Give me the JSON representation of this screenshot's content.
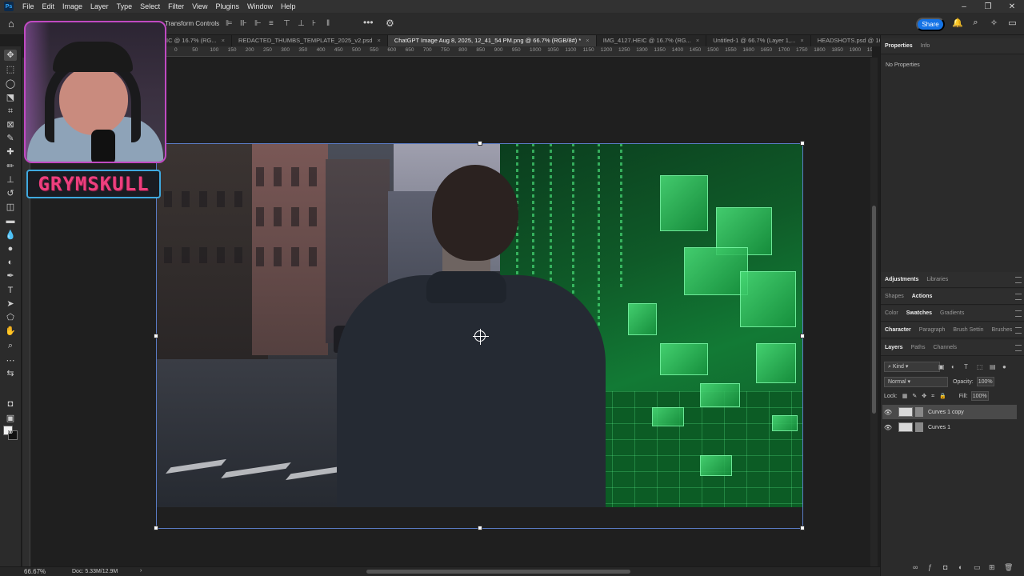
{
  "menu": [
    "File",
    "Edit",
    "Image",
    "Layer",
    "Type",
    "Select",
    "Filter",
    "View",
    "Plugins",
    "Window",
    "Help"
  ],
  "app_logo": "Ps",
  "window_controls": [
    "–",
    "❐",
    "✕"
  ],
  "options": {
    "label": "Transform Controls",
    "share_label": "Share"
  },
  "tabs": [
    {
      "label": "IC @ 16.7% (RG...",
      "active": false
    },
    {
      "label": "REDACTED_THUMBS_TEMPLATE_2025_v2.psd",
      "active": false
    },
    {
      "label": "ChatGPT Image Aug 8, 2025, 12_41_54 PM.png @ 66.7% (RGB/8#) *",
      "active": true
    },
    {
      "label": "IMG_4127.HEIC @ 16.7% (RG...",
      "active": false
    },
    {
      "label": "Untitled-1 @ 66.7% (Layer 1,...",
      "active": false
    },
    {
      "label": "HEADSHOTS.psd @ 16",
      "active": false
    }
  ],
  "ruler": [
    "0",
    "50",
    "100",
    "150",
    "200",
    "250",
    "300",
    "350",
    "400",
    "450",
    "500",
    "550",
    "600",
    "650",
    "700",
    "750",
    "800",
    "850",
    "900",
    "950",
    "1000",
    "1050",
    "1100",
    "1150",
    "1200",
    "1250",
    "1300",
    "1350",
    "1400",
    "1450",
    "1500",
    "1550",
    "1600",
    "1650",
    "1700",
    "1750",
    "1800",
    "1850",
    "1900",
    "1950"
  ],
  "overlay": {
    "brand": "GRYMSKULL"
  },
  "panels": {
    "properties_tabs": [
      "Properties",
      "Info"
    ],
    "no_properties": "No Properties",
    "adjust_tabs": [
      "Adjustments",
      "Libraries"
    ],
    "shapes_tabs": [
      "Shapes",
      "Actions"
    ],
    "color_tabs": [
      "Color",
      "Swatches",
      "Gradients"
    ],
    "char_tabs": [
      "Character",
      "Paragraph",
      "Brush Settin",
      "Brushes"
    ],
    "layers_tabs": [
      "Layers",
      "Paths",
      "Channels"
    ],
    "kind": "Kind",
    "blend_mode": "Normal",
    "opacity_label": "Opacity:",
    "opacity": "100%",
    "lock_label": "Lock:",
    "fill_label": "Fill:",
    "fill": "100%",
    "layers": [
      {
        "name": "Curves 1 copy",
        "selected": true
      },
      {
        "name": "Curves 1",
        "selected": false
      }
    ]
  },
  "status": {
    "zoom": "66.67%",
    "doc": "Doc: 5.33M/12.9M"
  }
}
